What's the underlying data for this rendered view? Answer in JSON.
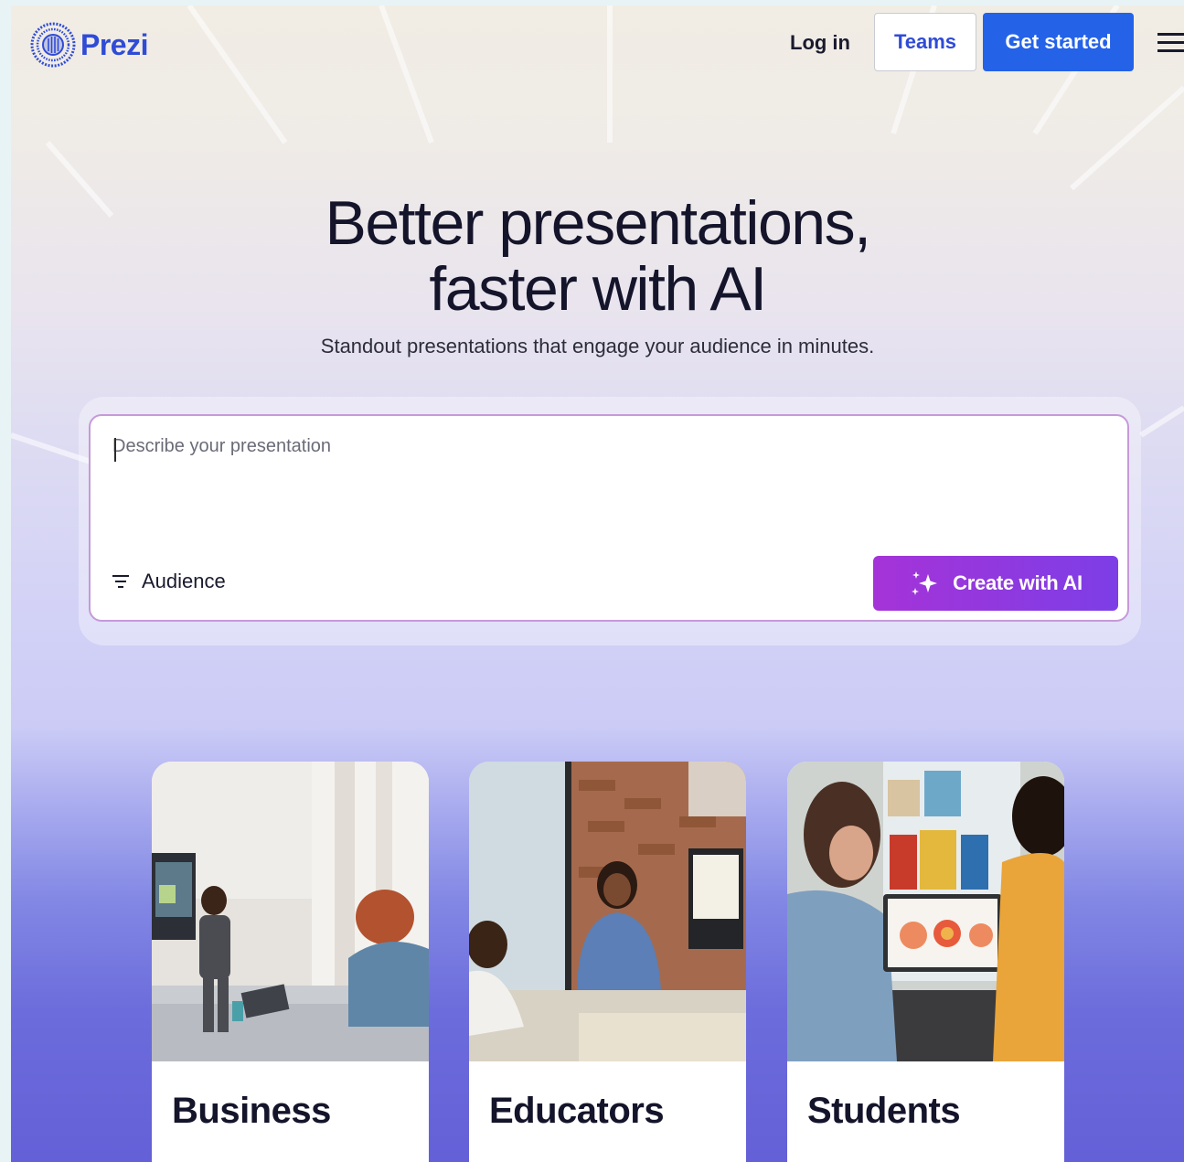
{
  "nav": {
    "logo_text": "Prezi",
    "login_label": "Log in",
    "teams_label": "Teams",
    "get_started_label": "Get started",
    "menu_icon": "hamburger-menu-icon"
  },
  "hero": {
    "title_line1": "Better presentations,",
    "title_line2": "faster with AI",
    "subtitle": "Standout presentations that engage your audience in minutes."
  },
  "prompt": {
    "placeholder": "Describe your presentation",
    "audience_label": "Audience",
    "audience_icon": "filter-icon",
    "create_label": "Create with AI",
    "create_icon": "sparkle-icon"
  },
  "cards": [
    {
      "title": "Business"
    },
    {
      "title": "Educators"
    },
    {
      "title": "Students"
    }
  ],
  "colors": {
    "brand_blue": "#2f4bd6",
    "primary_button": "#2462e8",
    "ai_gradient_start": "#a533d8",
    "ai_gradient_end": "#7d3ee6"
  }
}
